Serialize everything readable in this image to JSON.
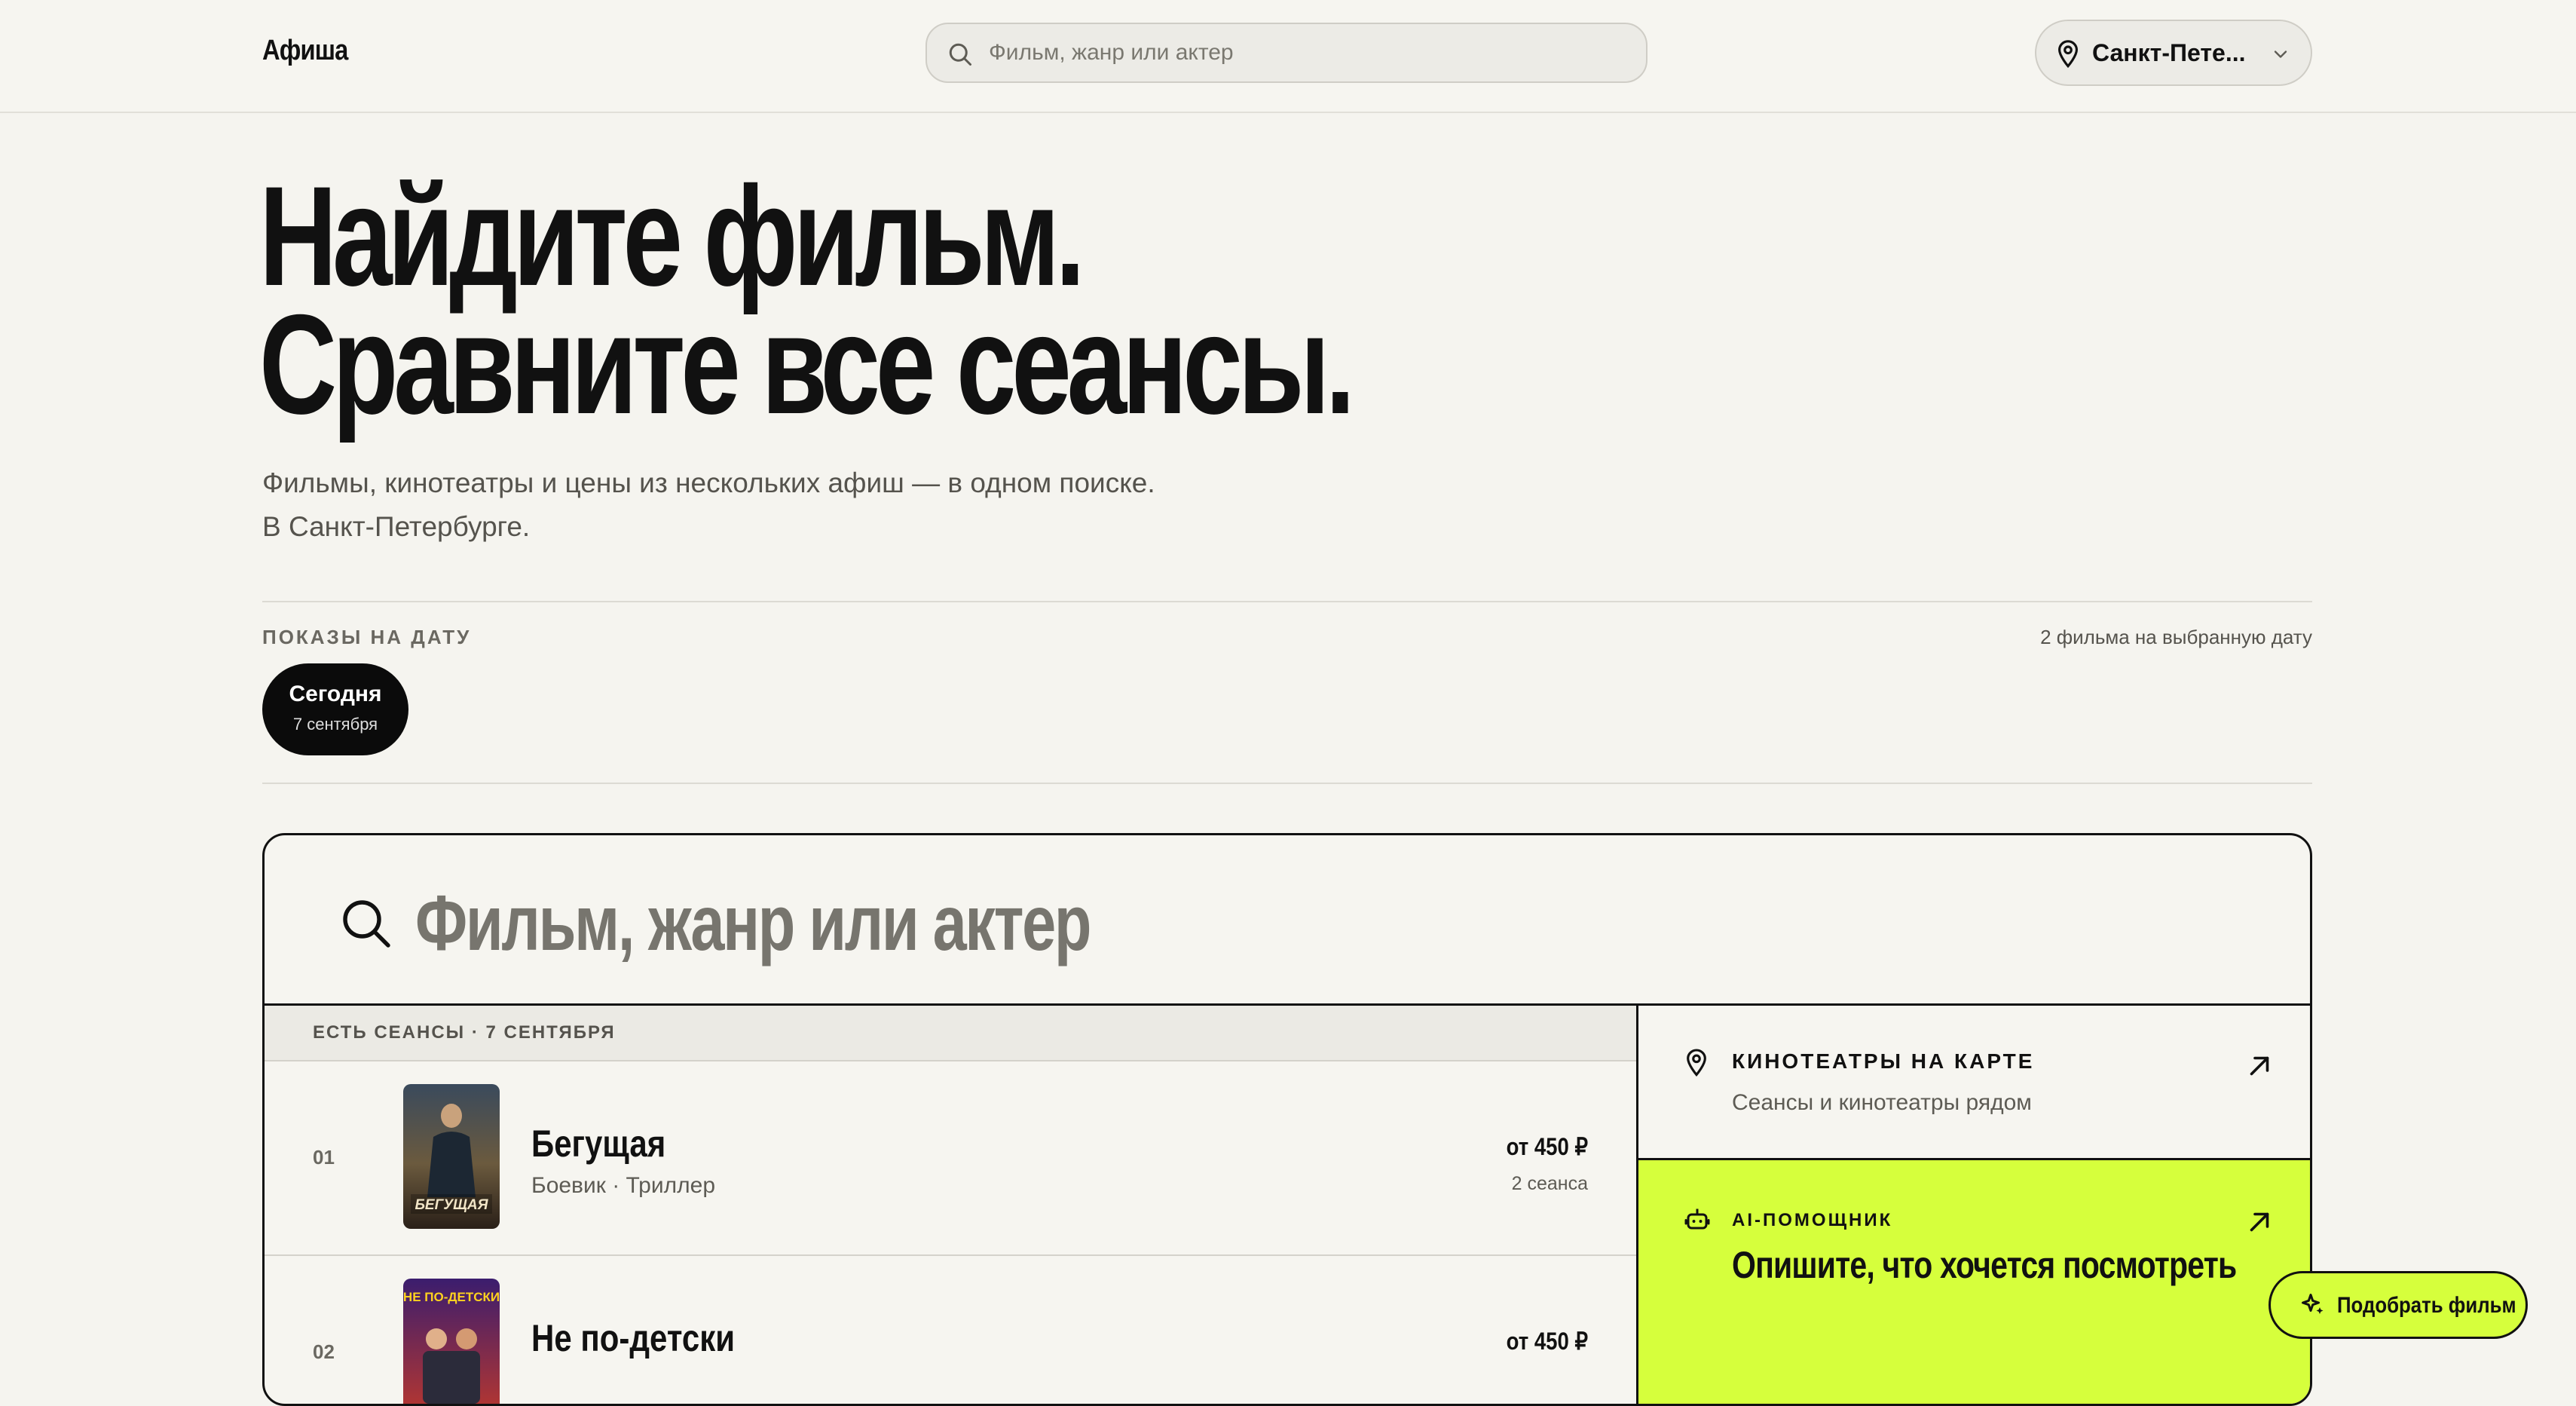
{
  "header": {
    "logo": "Афиша",
    "search_placeholder": "Фильм, жанр или актер",
    "city": "Санкт-Пете..."
  },
  "hero": {
    "title_line1": "Найдите фильм.",
    "title_line2": "Сравните все сеансы.",
    "subtitle_line1": "Фильмы, кинотеатры и цены из нескольких афиш — в одном поиске.",
    "subtitle_line2": "В Санкт-Петербурге."
  },
  "dates": {
    "label": "ПОКАЗЫ НА ДАТУ",
    "count_text": "2 фильма на выбранную дату",
    "selected": {
      "day": "Сегодня",
      "date": "7 сентября"
    }
  },
  "search_panel": {
    "placeholder": "Фильм, жанр или актер",
    "list_header": "ЕСТЬ СЕАНСЫ · 7 СЕНТЯБРЯ",
    "films": [
      {
        "num": "01",
        "title": "Бегущая",
        "genre": "Боевик · Триллер",
        "price": "от 450 ₽",
        "sessions": "2 сеанса",
        "poster_text": "БЕГУЩАЯ"
      },
      {
        "num": "02",
        "title": "Не по-детски",
        "genre": "",
        "price": "от 450 ₽",
        "sessions": "",
        "poster_text": "НЕ ПО-ДЕТСКИ"
      }
    ],
    "map_card": {
      "title": "КИНОТЕАТРЫ НА КАРТЕ",
      "subtitle": "Сеансы и кинотеатры рядом"
    },
    "ai_card": {
      "title": "AI-ПОМОЩНИК",
      "subtitle": "Опишите, что хочется посмотреть"
    }
  },
  "fab": {
    "label": "Подобрать фильм"
  },
  "colors": {
    "accent": "#d6ff3c",
    "background": "#f5f4ef",
    "text": "#111111"
  }
}
